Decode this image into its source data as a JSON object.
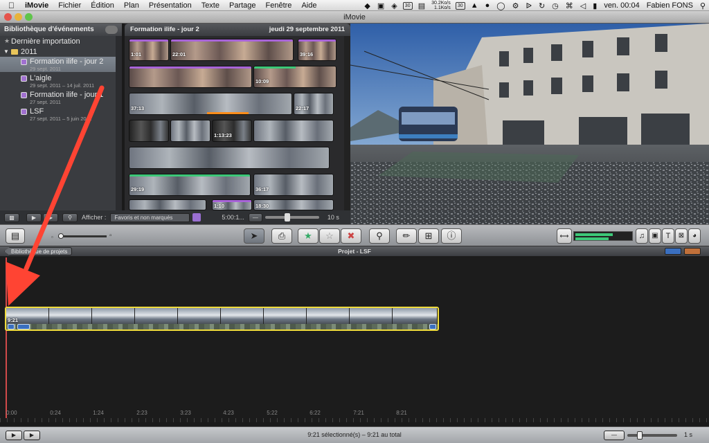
{
  "menubar": {
    "app": "iMovie",
    "items": [
      "Fichier",
      "Édition",
      "Plan",
      "Présentation",
      "Texte",
      "Partage",
      "Fenêtre",
      "Aide"
    ],
    "net_up": "30.2Ko/s",
    "net_down": "1.1Ko/s",
    "calendar_day": "30",
    "badge": "30",
    "clock": "ven. 00:04",
    "user": "Fabien FONS"
  },
  "window": {
    "title": "iMovie"
  },
  "event_library": {
    "header": "Bibliothèque d'événements",
    "last_import": "Dernière importation",
    "year": "2011",
    "events": [
      {
        "label": "Formation ilife - jour 2",
        "date": "29 sept. 2011",
        "selected": true
      },
      {
        "label": "L'aigle",
        "date": "29 sept. 2011 – 14 juil. 2011",
        "selected": false
      },
      {
        "label": "Formation ilife - jour 1",
        "date": "27 sept. 2011",
        "selected": false
      },
      {
        "label": "LSF",
        "date": "27 sept. 2011 – 5 juin 2011",
        "selected": false
      }
    ]
  },
  "browser": {
    "title": "Formation ilife - jour 2",
    "date": "jeudi 29 septembre 2011",
    "clips": [
      "1:01",
      "22:01",
      "39:16",
      "10:09",
      "37:13",
      "22:17",
      "1:13:23",
      "29:19",
      "36:17",
      "1:10",
      "18:30"
    ]
  },
  "event_toolbar": {
    "show_label": "Afficher :",
    "filter": "Favoris et non marqués",
    "duration": "5:00:1...",
    "thumb_size": "10 s"
  },
  "project": {
    "back_label": "Bibliothèque de projets",
    "title": "Projet - LSF",
    "clip_duration": "9:21"
  },
  "ruler": {
    "ticks": [
      "0:00",
      "0:24",
      "1:24",
      "2:23",
      "3:23",
      "4:23",
      "5:22",
      "6:22",
      "7:21",
      "8:21"
    ]
  },
  "status": {
    "selection": "9:21 sélectionné(s) – 9:21 au total",
    "zoom": "1 s"
  },
  "colors": {
    "selection_yellow": "#f0dc3c",
    "playhead": "#d24a4a",
    "annotation_arrow": "#ff4433",
    "event_purple": "#a070d0",
    "audio_green": "#3cc878"
  }
}
